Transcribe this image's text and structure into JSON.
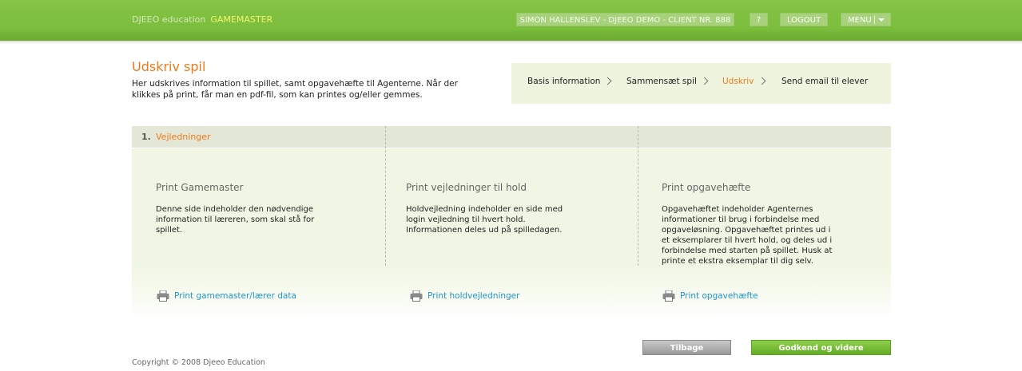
{
  "header": {
    "brand_primary": "DJEEO education",
    "brand_secondary": "GAMEMASTER",
    "user_label": "SIMON HALLENSLEV - DJEEO DEMO - CLIENT NR. 888",
    "help_label": "?",
    "logout_label": "LOGOUT",
    "menu_label": "MENU"
  },
  "page": {
    "title": "Udskriv spil",
    "description": "Her udskrives information til spillet, samt opgavehæfte til Agenterne. Når der klikkes på print, får man en pdf-fil, som kan printes og/eller gemmes."
  },
  "steps": [
    {
      "label": "Basis information"
    },
    {
      "label": "Sammensæt spil"
    },
    {
      "label": "Udskriv"
    },
    {
      "label": "Send email til elever"
    }
  ],
  "section": {
    "number": "1.",
    "title": "Vejledninger"
  },
  "columns": [
    {
      "title": "Print Gamemaster",
      "text": "Denne side indeholder den nødvendige information til læreren, som skal stå for spillet.",
      "link": "Print gamemaster/lærer data"
    },
    {
      "title": "Print vejledninger til hold",
      "text": "Holdvejledning indeholder en side med login vejledning til hvert hold. Informationen deles ud på spilledagen.",
      "link": "Print holdvejledninger"
    },
    {
      "title": "Print opgavehæfte",
      "text": "Opgavehæftet indeholder Agenternes informationer til brug i forbindelse med opgaveløsning. Opgavehæftet printes ud i et eksemplarer til hvert hold, og deles ud i forbindelse med starten på spillet. Husk at printe et ekstra eksemplar til dig selv.",
      "link": "Print opgavehæfte"
    }
  ],
  "buttons": {
    "back": "Tilbage",
    "next": "Godkend og videre"
  },
  "footer": {
    "copyright": "Copyright © 2008 Djeeo Education"
  },
  "colors": {
    "brand_green": "#7bbd3c",
    "accent_orange": "#f07a1a",
    "link_blue": "#2494c9"
  }
}
